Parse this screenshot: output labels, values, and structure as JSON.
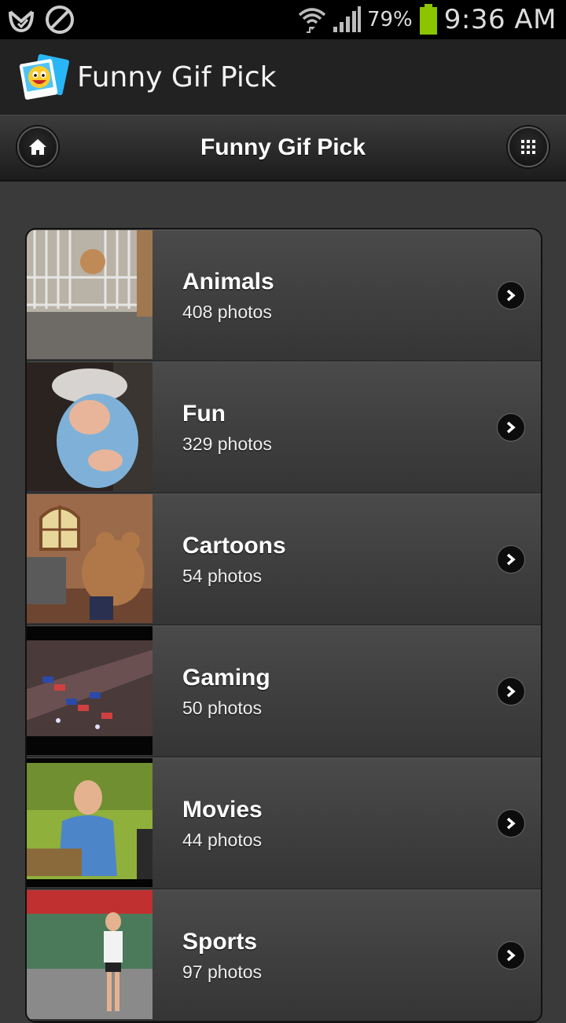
{
  "status_bar": {
    "battery_percent": "79%",
    "time": "9:36 AM",
    "icons": [
      "voicemail-icon",
      "blocked-icon",
      "wifi-icon",
      "signal-icon",
      "battery-icon"
    ]
  },
  "action_bar": {
    "title": "Funny Gif Pick",
    "icon": "app-logo-icon"
  },
  "toolbar": {
    "title": "Funny Gif Pick",
    "left_icon": "home-icon",
    "right_icon": "grid-icon"
  },
  "categories": [
    {
      "title": "Animals",
      "count": "408 photos"
    },
    {
      "title": "Fun",
      "count": "329 photos"
    },
    {
      "title": "Cartoons",
      "count": "54 photos"
    },
    {
      "title": "Gaming",
      "count": "50 photos"
    },
    {
      "title": "Movies",
      "count": "44 photos"
    },
    {
      "title": "Sports",
      "count": "97 photos"
    }
  ],
  "colors": {
    "background": "#3a3a3a",
    "battery_green": "#8bc400"
  }
}
